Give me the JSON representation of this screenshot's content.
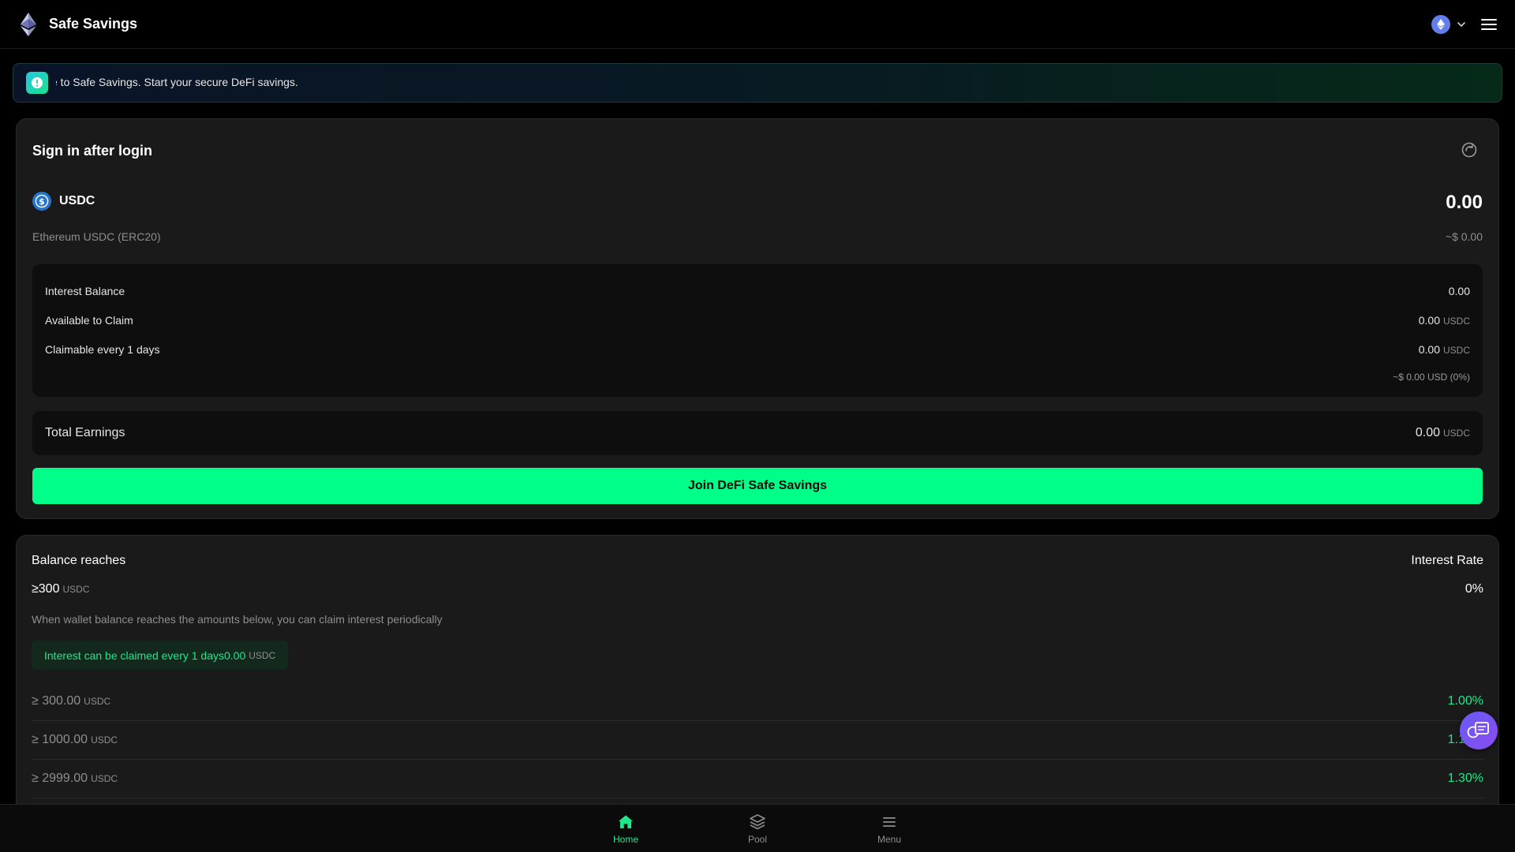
{
  "app": {
    "title": "Safe Savings"
  },
  "notice": {
    "text": "e to Safe Savings. Start your secure DeFi savings."
  },
  "account": {
    "title": "Sign in after login",
    "token": {
      "symbol": "USDC",
      "amount": "0.00",
      "network_label": "Ethereum USDC (ERC20)",
      "usd_value": "~$ 0.00"
    },
    "interest": {
      "rows": [
        {
          "label": "Interest Balance",
          "value": "0.00",
          "unit": ""
        },
        {
          "label": "Available to Claim",
          "value": "0.00",
          "unit": "USDC"
        },
        {
          "label": "Claimable every 1 days",
          "value": "0.00",
          "unit": "USDC"
        }
      ],
      "footnote": "~$ 0.00 USD (0%)"
    },
    "total_earnings": {
      "label": "Total Earnings",
      "value": "0.00",
      "unit": "USDC"
    },
    "join_button": "Join DeFi Safe Savings"
  },
  "rates": {
    "left_title": "Balance reaches",
    "right_title": "Interest Rate",
    "min_value": "≥300",
    "min_unit": "USDC",
    "current_rate": "0%",
    "description": "When wallet balance reaches the amounts below, you can claim interest periodically",
    "claim_badge": {
      "text": "Interest can be claimed every 1 days0.00",
      "unit": "USDC"
    },
    "tiers": [
      {
        "min": "≥ 300.00",
        "unit": "USDC",
        "rate": "1.00%"
      },
      {
        "min": "≥ 1000.00",
        "unit": "USDC",
        "rate": "1.10%"
      },
      {
        "min": "≥ 2999.00",
        "unit": "USDC",
        "rate": "1.30%"
      }
    ]
  },
  "nav": {
    "items": [
      {
        "label": "Home",
        "icon": "home-icon",
        "active": true
      },
      {
        "label": "Pool",
        "icon": "layers-icon",
        "active": false
      },
      {
        "label": "Menu",
        "icon": "menu-icon",
        "active": false
      }
    ]
  },
  "colors": {
    "accent": "#00ff88",
    "accent_text": "#1ee88a",
    "background": "#000000",
    "card": "#1a1a1a",
    "usdc_blue": "#2775ca",
    "eth_blue": "#627eea"
  }
}
